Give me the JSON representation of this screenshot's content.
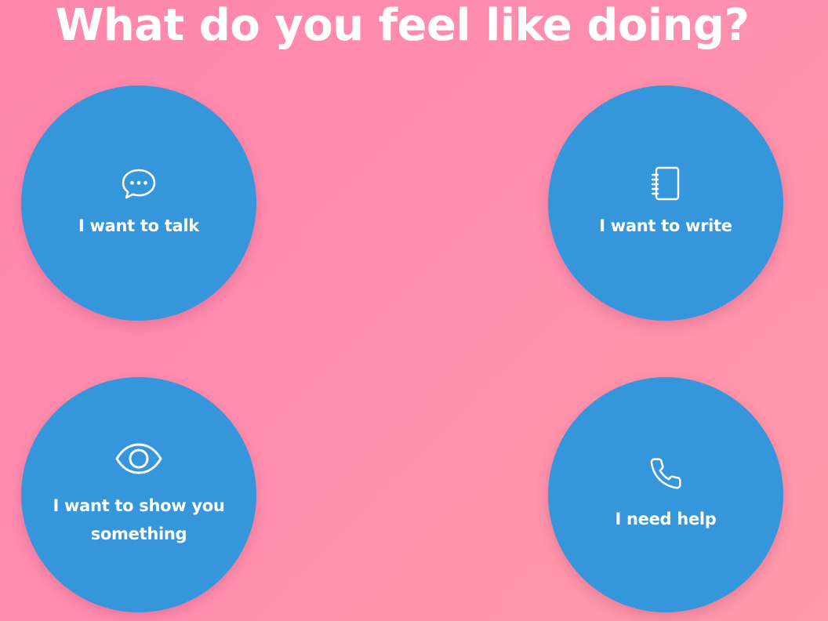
{
  "header": {
    "title": "What do you feel like doing?"
  },
  "options": [
    {
      "label": "I want to talk",
      "icon": "chat-bubble-icon"
    },
    {
      "label": "I want to write",
      "icon": "notebook-icon"
    },
    {
      "label": "I want to show you something",
      "icon": "eye-icon"
    },
    {
      "label": "I need help",
      "icon": "phone-icon"
    }
  ],
  "colors": {
    "background_start": "#ff86ad",
    "background_end": "#ff9aa8",
    "circle": "#3696db",
    "text": "#ffffff"
  }
}
